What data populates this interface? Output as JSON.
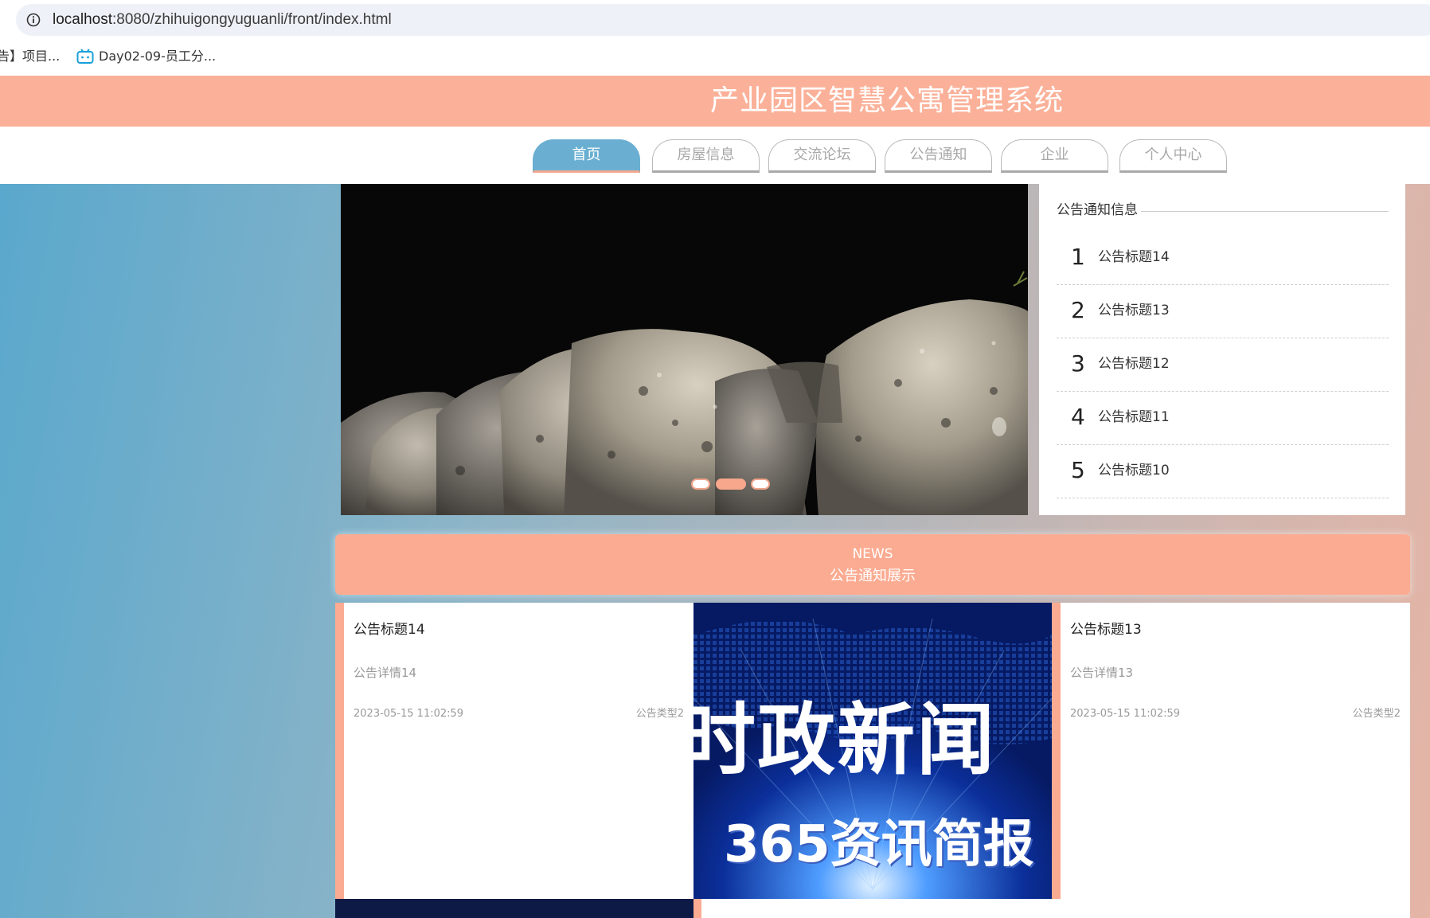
{
  "browser": {
    "url_host": "localhost",
    "url_rest": ":8080/zhihuigongyuguanli/front/index.html",
    "bookmarks": [
      {
        "label": "告】项目..."
      },
      {
        "label": "Day02-09-员工分..."
      }
    ]
  },
  "site": {
    "title": "产业园区智慧公寓管理系统"
  },
  "nav": {
    "items": [
      {
        "label": "首页",
        "active": true
      },
      {
        "label": "房屋信息"
      },
      {
        "label": "交流论坛"
      },
      {
        "label": "公告通知"
      },
      {
        "label": "企业"
      },
      {
        "label": "个人中心"
      }
    ]
  },
  "carousel": {
    "active_index": 1,
    "slide_count": 3
  },
  "notice_panel": {
    "heading": "公告通知信息",
    "items": [
      {
        "num": "1",
        "title": "公告标题14"
      },
      {
        "num": "2",
        "title": "公告标题13"
      },
      {
        "num": "3",
        "title": "公告标题12"
      },
      {
        "num": "4",
        "title": "公告标题11"
      },
      {
        "num": "5",
        "title": "公告标题10"
      }
    ]
  },
  "news": {
    "en": "NEWS",
    "cn": "公告通知展示",
    "cards": [
      {
        "title": "公告标题14",
        "desc": "公告详情14",
        "date": "2023-05-15 11:02:59",
        "type": "公告类型2"
      },
      {
        "title": "公告标题13",
        "desc": "公告详情13",
        "date": "2023-05-15 11:02:59",
        "type": "公告类型2"
      }
    ],
    "image_text_big": "时政新闻",
    "image_text_small": "365资讯简报"
  },
  "colors": {
    "header": "#fbb199",
    "accent_blue": "#6aafd2",
    "banner": "#fbab91"
  }
}
